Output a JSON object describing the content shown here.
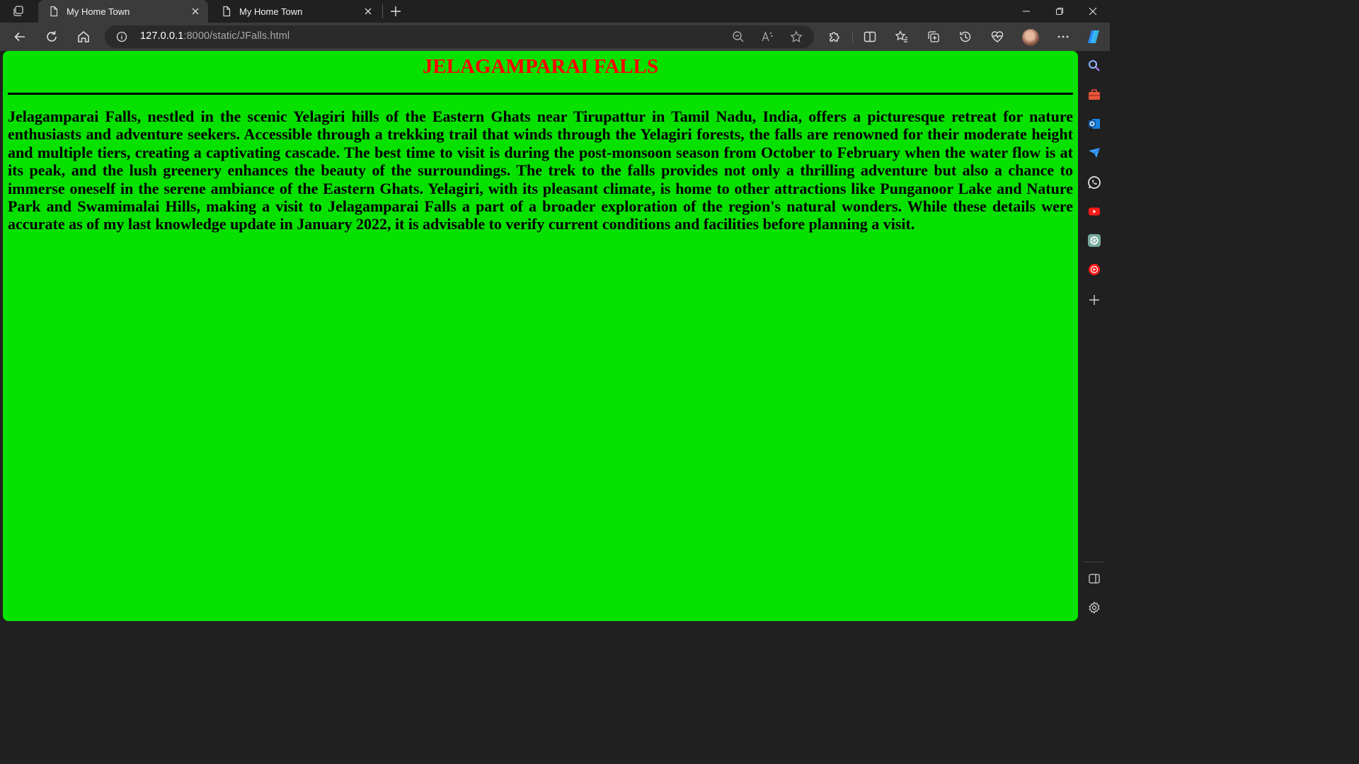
{
  "browser": {
    "tabs": [
      {
        "title": "My Home Town",
        "active": true,
        "icon": "page-icon"
      },
      {
        "title": "My Home Town",
        "active": false,
        "icon": "page-icon"
      }
    ],
    "address": {
      "host": "127.0.0.1",
      "path": ":8000/static/JFalls.html"
    },
    "accent": "#3b3b3b",
    "sidebar_icons": [
      "search-icon",
      "toolbox-icon",
      "outlook-icon",
      "send-icon",
      "whatsapp-icon",
      "youtube-icon",
      "chatgpt-icon",
      "music-icon",
      "add-icon",
      "split-panel-icon",
      "settings-icon"
    ]
  },
  "page": {
    "background": "#07e100",
    "title": "JELAGAMPARAI FALLS",
    "title_color": "#ff0000",
    "body": "Jelagamparai Falls, nestled in the scenic Yelagiri hills of the Eastern Ghats near Tirupattur in Tamil Nadu, India, offers a picturesque retreat for nature enthusiasts and adventure seekers. Accessible through a trekking trail that winds through the Yelagiri forests, the falls are renowned for their moderate height and multiple tiers, creating a captivating cascade. The best time to visit is during the post-monsoon season from October to February when the water flow is at its peak, and the lush greenery enhances the beauty of the surroundings. The trek to the falls provides not only a thrilling adventure but also a chance to immerse oneself in the serene ambiance of the Eastern Ghats. Yelagiri, with its pleasant climate, is home to other attractions like Punganoor Lake and Nature Park and Swamimalai Hills, making a visit to Jelagamparai Falls a part of a broader exploration of the region's natural wonders. While these details were accurate as of my last knowledge update in January 2022, it is advisable to verify current conditions and facilities before planning a visit."
  }
}
